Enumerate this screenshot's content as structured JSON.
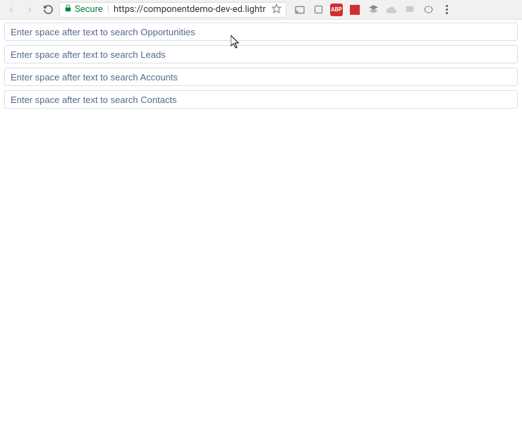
{
  "browser": {
    "secure_label": "Secure",
    "url": "https://componentdemo-dev-ed.lightr",
    "abp_label": "ABP"
  },
  "inputs": {
    "opportunities_placeholder": "Enter space after text to search Opportunities",
    "leads_placeholder": "Enter space after text to search Leads",
    "accounts_placeholder": "Enter space after text to search Accounts",
    "contacts_placeholder": "Enter space after text to search Contacts"
  }
}
